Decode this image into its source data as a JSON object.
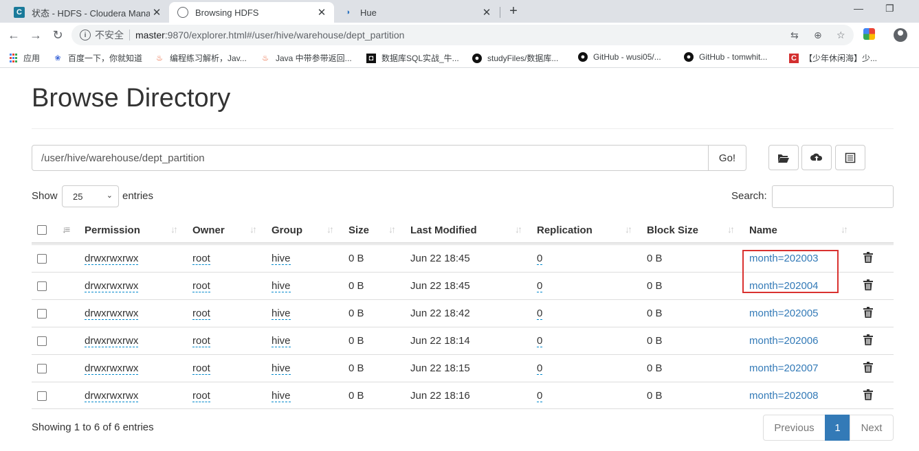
{
  "browser": {
    "tabs": [
      {
        "title": "状态 - HDFS - Cloudera Manag",
        "icon": "cloudera-c-icon",
        "active": false
      },
      {
        "title": "Browsing HDFS",
        "icon": "globe-icon",
        "active": true
      },
      {
        "title": "Hue",
        "icon": "hue-icon",
        "active": false
      }
    ],
    "address": {
      "security": "不安全",
      "host": "master",
      "rest": ":9870/explorer.html#/user/hive/warehouse/dept_partition"
    },
    "bookmarks": [
      {
        "label": "应用",
        "icon": "apps-grid-icon"
      },
      {
        "label": "百度一下，你就知道",
        "icon": "baidu-paw-icon"
      },
      {
        "label": "编程练习解析，Jav...",
        "icon": "flame-icon"
      },
      {
        "label": "Java 中带参带返回...",
        "icon": "flame-icon"
      },
      {
        "label": "数据库SQL实战_牛...",
        "icon": "nowcoder-icon"
      },
      {
        "label": "studyFiles/数据库...",
        "icon": "github-icon"
      },
      {
        "label": "GitHub - wusi05/...",
        "icon": "github-icon"
      },
      {
        "label": "GitHub - tomwhit...",
        "icon": "github-icon"
      },
      {
        "label": "【少年休闲海】少...",
        "icon": "csdn-icon"
      }
    ]
  },
  "page": {
    "title": "Browse Directory",
    "path_value": "/user/hive/warehouse/dept_partition",
    "go_label": "Go!",
    "show_label": "Show",
    "entries_label": "entries",
    "page_length": "25",
    "search_label": "Search:",
    "columns": [
      "Permission",
      "Owner",
      "Group",
      "Size",
      "Last Modified",
      "Replication",
      "Block Size",
      "Name"
    ],
    "rows": [
      {
        "permission": "drwxrwxrwx",
        "owner": "root",
        "group": "hive",
        "size": "0 B",
        "modified": "Jun 22 18:45",
        "replication": "0",
        "block_size": "0 B",
        "name": "month=202003"
      },
      {
        "permission": "drwxrwxrwx",
        "owner": "root",
        "group": "hive",
        "size": "0 B",
        "modified": "Jun 22 18:45",
        "replication": "0",
        "block_size": "0 B",
        "name": "month=202004"
      },
      {
        "permission": "drwxrwxrwx",
        "owner": "root",
        "group": "hive",
        "size": "0 B",
        "modified": "Jun 22 18:42",
        "replication": "0",
        "block_size": "0 B",
        "name": "month=202005"
      },
      {
        "permission": "drwxrwxrwx",
        "owner": "root",
        "group": "hive",
        "size": "0 B",
        "modified": "Jun 22 18:14",
        "replication": "0",
        "block_size": "0 B",
        "name": "month=202006"
      },
      {
        "permission": "drwxrwxrwx",
        "owner": "root",
        "group": "hive",
        "size": "0 B",
        "modified": "Jun 22 18:15",
        "replication": "0",
        "block_size": "0 B",
        "name": "month=202007"
      },
      {
        "permission": "drwxrwxrwx",
        "owner": "root",
        "group": "hive",
        "size": "0 B",
        "modified": "Jun 22 18:16",
        "replication": "0",
        "block_size": "0 B",
        "name": "month=202008"
      }
    ],
    "info": "Showing 1 to 6 of 6 entries",
    "pagination": {
      "previous": "Previous",
      "current": "1",
      "next": "Next"
    }
  },
  "colors": {
    "link": "#337ab7",
    "highlight": "#d9312f",
    "active_page": "#337ab7"
  }
}
